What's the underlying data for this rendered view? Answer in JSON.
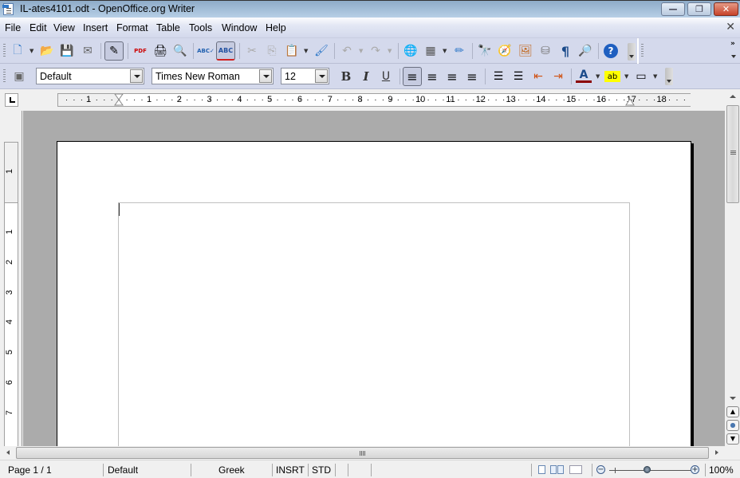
{
  "window": {
    "title": "IL-ates4101.odt - OpenOffice.org Writer",
    "minimize_label": "—",
    "restore_label": "❐",
    "close_label": "✕"
  },
  "menubar": {
    "items": [
      {
        "label": "File"
      },
      {
        "label": "Edit"
      },
      {
        "label": "View"
      },
      {
        "label": "Insert"
      },
      {
        "label": "Format"
      },
      {
        "label": "Table"
      },
      {
        "label": "Tools"
      },
      {
        "label": "Window"
      },
      {
        "label": "Help"
      }
    ],
    "close_doc_label": "✕"
  },
  "standard_toolbar": {
    "buttons": [
      {
        "name": "new-document",
        "glyph": "🗋"
      },
      {
        "name": "open",
        "glyph": "📂"
      },
      {
        "name": "save",
        "glyph": "💾"
      },
      {
        "name": "email",
        "glyph": "✉"
      },
      {
        "name": "edit-file",
        "glyph": "✎"
      },
      {
        "name": "export-pdf",
        "glyph": "PDF"
      },
      {
        "name": "print",
        "glyph": "🖨"
      },
      {
        "name": "page-preview",
        "glyph": "🔍"
      },
      {
        "name": "spellcheck",
        "glyph": "ABC✓"
      },
      {
        "name": "autospellcheck",
        "glyph": "ABC"
      },
      {
        "name": "cut",
        "glyph": "✂"
      },
      {
        "name": "copy",
        "glyph": "⎘"
      },
      {
        "name": "paste",
        "glyph": "📋"
      },
      {
        "name": "clone-formatting",
        "glyph": "🖌"
      },
      {
        "name": "undo",
        "glyph": "↶"
      },
      {
        "name": "redo",
        "glyph": "↷"
      },
      {
        "name": "hyperlink",
        "glyph": "🌐"
      },
      {
        "name": "table",
        "glyph": "▦"
      },
      {
        "name": "show-draw-functions",
        "glyph": "✏"
      },
      {
        "name": "find-replace",
        "glyph": "🔭"
      },
      {
        "name": "navigator",
        "glyph": "🧭"
      },
      {
        "name": "gallery",
        "glyph": "🖼"
      },
      {
        "name": "data-sources",
        "glyph": "⛁"
      },
      {
        "name": "formatting-marks",
        "glyph": "¶"
      },
      {
        "name": "zoom",
        "glyph": "🔎"
      },
      {
        "name": "help",
        "glyph": "?"
      }
    ]
  },
  "formatting_toolbar": {
    "styles_icon": "▣",
    "paragraph_style": "Default",
    "font_name": "Times New Roman",
    "font_size": "12",
    "bold": "B",
    "italic": "I",
    "underline": "U",
    "align_left": "≡",
    "align_center": "≡",
    "align_right": "≡",
    "justify": "≡",
    "numbering": "☰",
    "bullets": "☰",
    "decrease_indent": "⇤",
    "increase_indent": "⇥",
    "font_color": "A",
    "highlight": "ab",
    "background": "▭",
    "font_color_hex": "#8b0000",
    "highlight_hex": "#ffff00"
  },
  "ruler": {
    "h_left_label": "1",
    "h_labels": [
      "1",
      "2",
      "3",
      "4",
      "5",
      "6",
      "7",
      "8",
      "9",
      "10",
      "11",
      "12",
      "13",
      "14",
      "15",
      "16",
      "17",
      "18"
    ],
    "v_top_label": "1",
    "v_labels": [
      "1",
      "2",
      "3",
      "4",
      "5",
      "6",
      "7"
    ]
  },
  "statusbar": {
    "page": "Page 1 / 1",
    "page_style": "Default",
    "language": "Greek",
    "insert_mode": "INSRT",
    "selection_mode": "STD",
    "zoom_percent": "100%",
    "zoom_minus": "−",
    "zoom_plus": "+"
  },
  "vertical_nav": {
    "prev_label": "▲",
    "nav_label": "●",
    "next_label": "▼"
  }
}
